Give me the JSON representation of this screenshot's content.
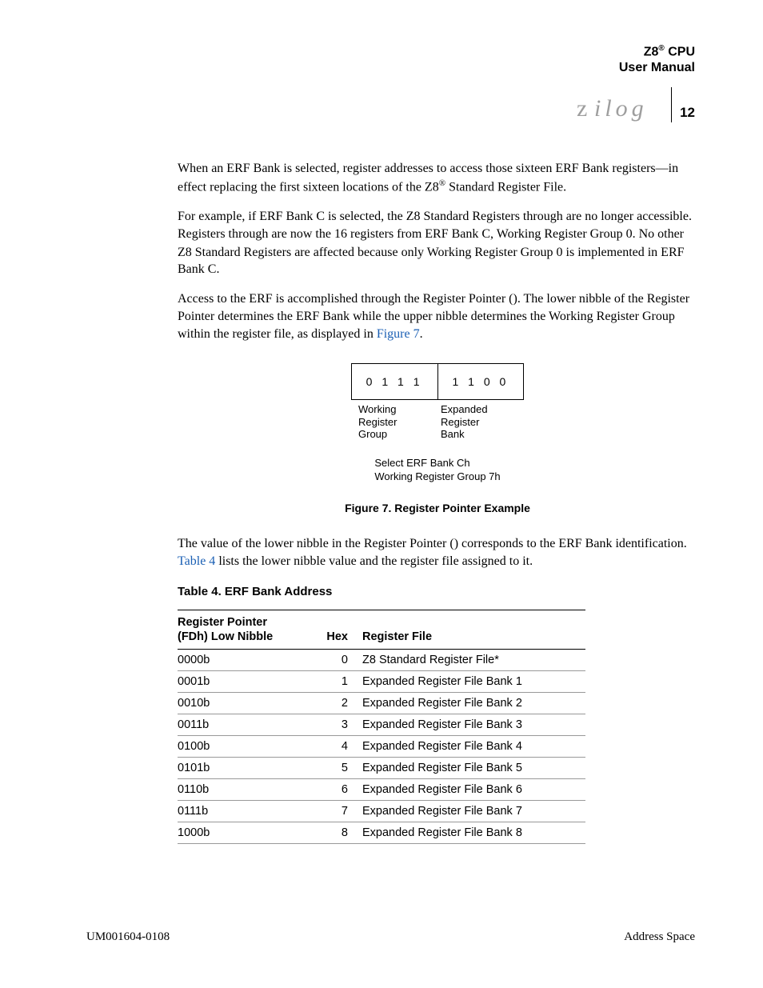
{
  "header": {
    "product_line1": "Z8",
    "product_reg": "®",
    "product_after": " CPU",
    "product_line2": "User Manual",
    "page_number": "12"
  },
  "paragraphs": {
    "p1a": "When an ERF Bank is selected, register addresses ",
    "p1_code1": "",
    "p1b": " to ",
    "p1_code2": "",
    "p1c": " access those sixteen ERF Bank registers—in effect replacing the first sixteen locations of the Z8",
    "p1_reg": "®",
    "p1d": " Standard Register File.",
    "p2a": "For example, if ERF Bank C is selected, the Z8 Standard Registers ",
    "p2_code1": "",
    "p2b": " through ",
    "p2_code2": "",
    "p2c": " are no longer accessible. Registers ",
    "p2_code3": "",
    "p2d": " through ",
    "p2_code4": "",
    "p2e": " are now the 16 registers from ERF Bank C, Working Register Group 0. No other Z8 Standard Registers are affected because only Working Register Group 0 is implemented in ERF Bank C.",
    "p3a": "Access to the ERF is accomplished through the Register Pointer (",
    "p3_code1": "",
    "p3b": "). The lower nibble of the Register Pointer determines the ERF Bank while the upper nibble determines the Working Register Group within the register file, as displayed in ",
    "p3_link": "Figure 7",
    "p3c": ".",
    "p4a": "The value of the lower nibble in the Register Pointer (",
    "p4_code1": "",
    "p4b": ") corresponds to the ERF Bank identification. ",
    "p4_link": "Table 4",
    "p4c": " lists the lower nibble value and the register file assigned to it."
  },
  "figure7": {
    "cell_left": "0 1 1 1",
    "cell_right": "1 1 0 0",
    "label_left_l1": "Working",
    "label_left_l2": "Register",
    "label_left_l3": "Group",
    "label_right_l1": "Expanded",
    "label_right_l2": "Register",
    "label_right_l3": "Bank",
    "caption_l1": "Select ERF Bank Ch",
    "caption_l2": "Working Register Group 7h",
    "title": "Figure 7. Register Pointer Example"
  },
  "table4": {
    "title": "Table 4. ERF Bank Address",
    "head_col1_l1": "Register Pointer",
    "head_col1_l2": "(FDh) Low Nibble",
    "head_col2": "Hex",
    "head_col3": "Register File",
    "rows": [
      {
        "nibble": "0000b",
        "hex": "0",
        "file": "Z8 Standard Register File*"
      },
      {
        "nibble": "0001b",
        "hex": "1",
        "file": "Expanded Register File Bank 1"
      },
      {
        "nibble": "0010b",
        "hex": "2",
        "file": "Expanded Register File Bank 2"
      },
      {
        "nibble": "0011b",
        "hex": "3",
        "file": "Expanded Register File Bank 3"
      },
      {
        "nibble": "0100b",
        "hex": "4",
        "file": "Expanded Register File Bank 4"
      },
      {
        "nibble": "0101b",
        "hex": "5",
        "file": "Expanded Register File Bank 5"
      },
      {
        "nibble": "0110b",
        "hex": "6",
        "file": "Expanded Register File Bank 6"
      },
      {
        "nibble": "0111b",
        "hex": "7",
        "file": "Expanded Register File Bank 7"
      },
      {
        "nibble": "1000b",
        "hex": "8",
        "file": "Expanded Register File Bank 8"
      }
    ]
  },
  "footer": {
    "left": "UM001604-0108",
    "right": "Address Space"
  }
}
